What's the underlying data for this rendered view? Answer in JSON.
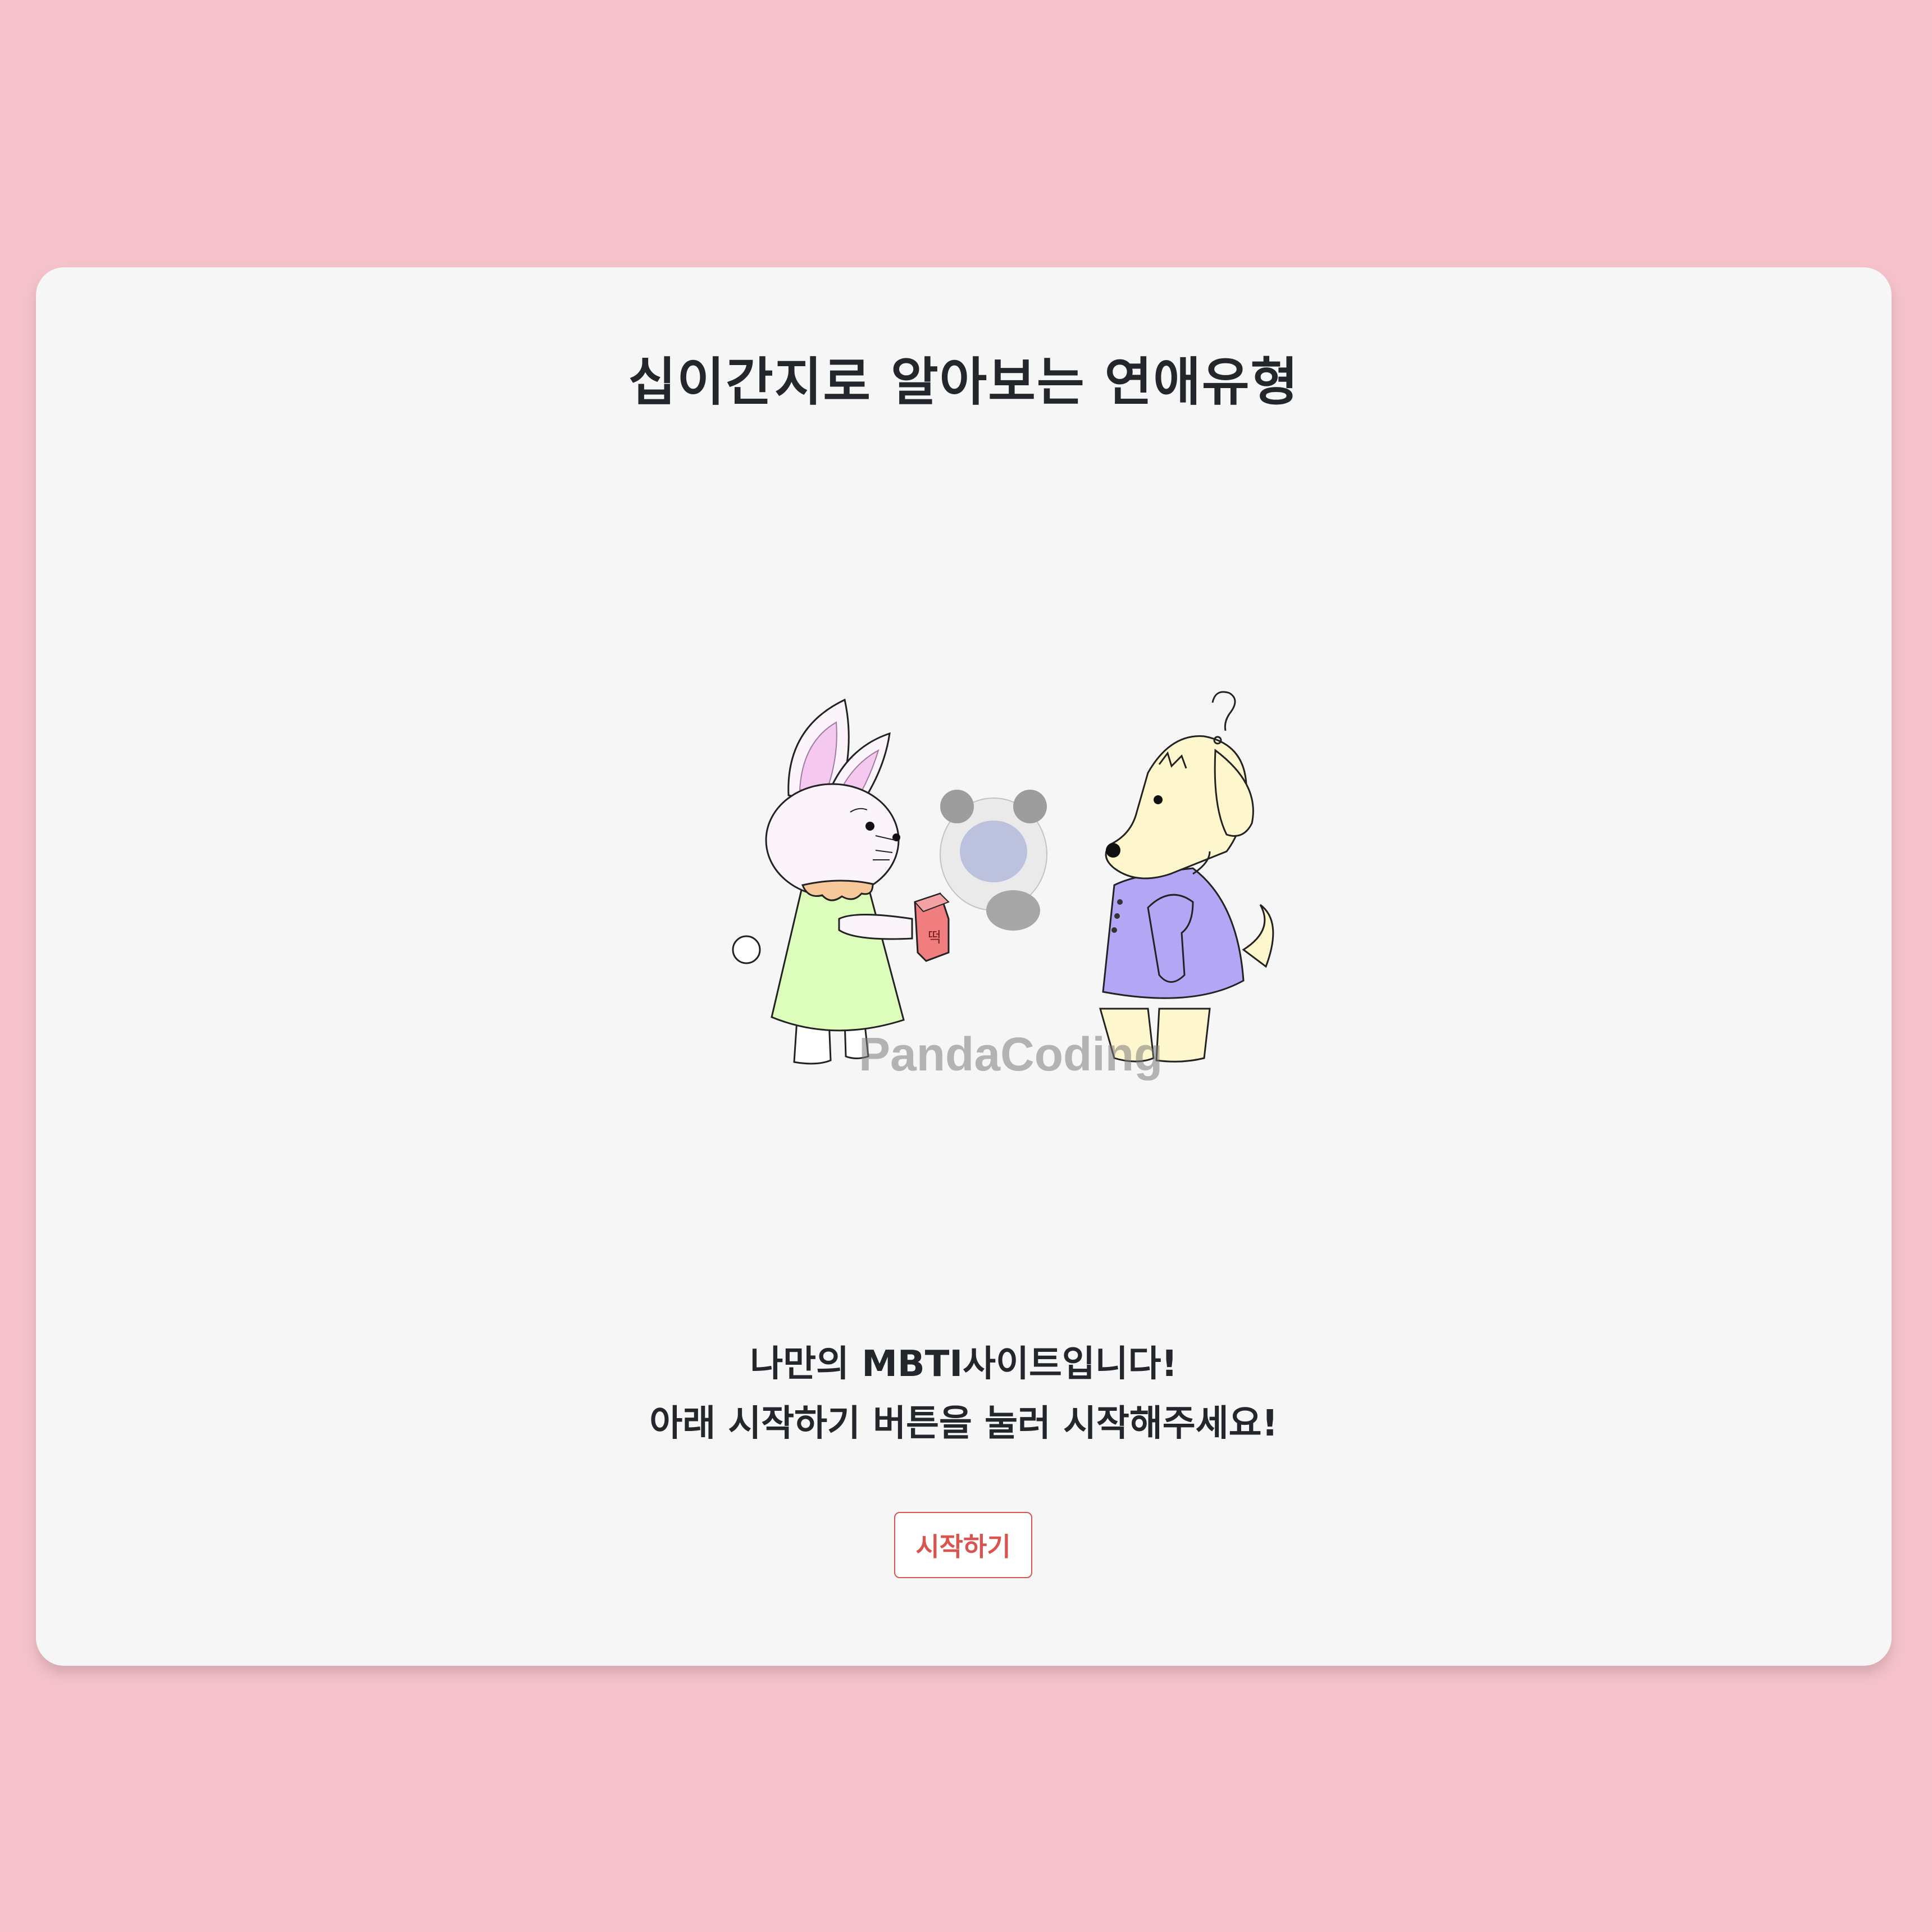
{
  "page": {
    "background_color": "#f5c2cb",
    "card_color": "#f6f6f6"
  },
  "header": {
    "title": "십이간지로 알아보는 연애유형"
  },
  "illustration": {
    "description_icon": "rabbit-gives-gift-to-dog",
    "box_char": "떡",
    "watermark": "PandaCoding"
  },
  "intro": {
    "line1": "나만의 MBTI사이트입니다!",
    "line2": "아래 시작하기 버튼을 눌러 시작해주세요!"
  },
  "actions": {
    "start_label": "시작하기",
    "start_color": "#d9534f"
  }
}
